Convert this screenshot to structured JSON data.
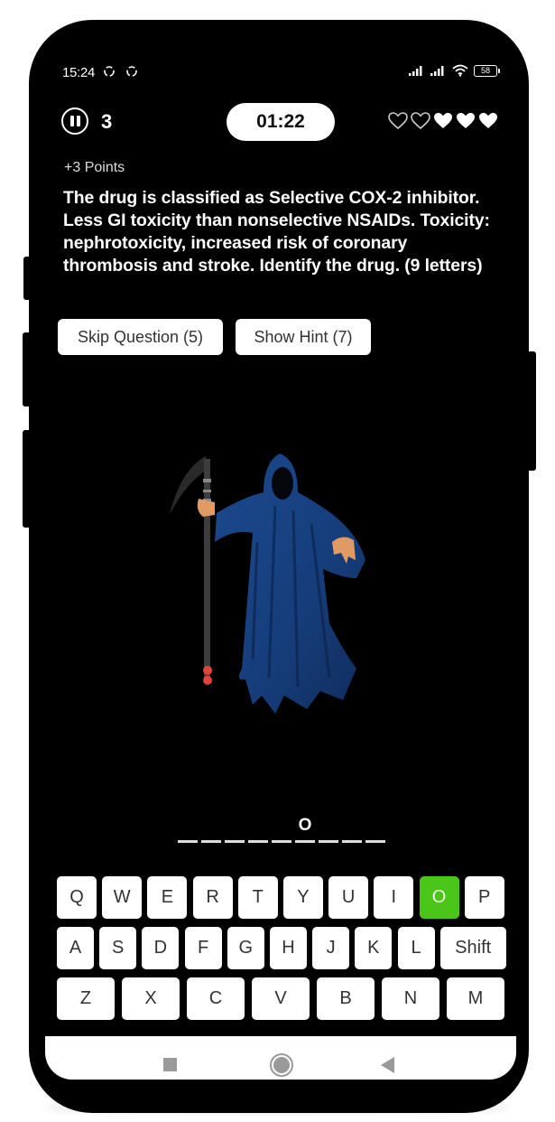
{
  "status_bar": {
    "time": "15:24",
    "battery": "58",
    "icons": [
      "sync-icon",
      "sync-icon",
      "signal-icon",
      "signal-icon",
      "wifi-icon",
      "battery-icon"
    ]
  },
  "game": {
    "level": "3",
    "timer": "01:22",
    "lives": {
      "total": 5,
      "remaining": 3
    },
    "points_label": "+3 Points",
    "question": "The drug is classified as Selective COX-2 inhibitor. Less GI toxicity than nonselective NSAIDs. Toxicity: nephrotoxicity, increased risk of coronary thrombosis and stroke. Identify the drug. (9 letters)",
    "skip_button": "Skip Question (5)",
    "hint_button": "Show Hint (7)",
    "image": "grim-reaper-illustration"
  },
  "answer": {
    "length": 9,
    "slots": [
      "",
      "",
      "",
      "",
      "",
      "O",
      "",
      "",
      ""
    ]
  },
  "keyboard": {
    "rows": [
      [
        "Q",
        "W",
        "E",
        "R",
        "T",
        "Y",
        "U",
        "I",
        "O",
        "P"
      ],
      [
        "A",
        "S",
        "D",
        "F",
        "G",
        "H",
        "J",
        "K",
        "L",
        "Shift"
      ],
      [
        "Z",
        "X",
        "C",
        "V",
        "B",
        "N",
        "M"
      ]
    ],
    "used_keys": [
      "O"
    ],
    "active_color": "#4cc51b"
  },
  "nav_bar": {
    "buttons": [
      "recents-button",
      "home-button",
      "back-button"
    ]
  }
}
